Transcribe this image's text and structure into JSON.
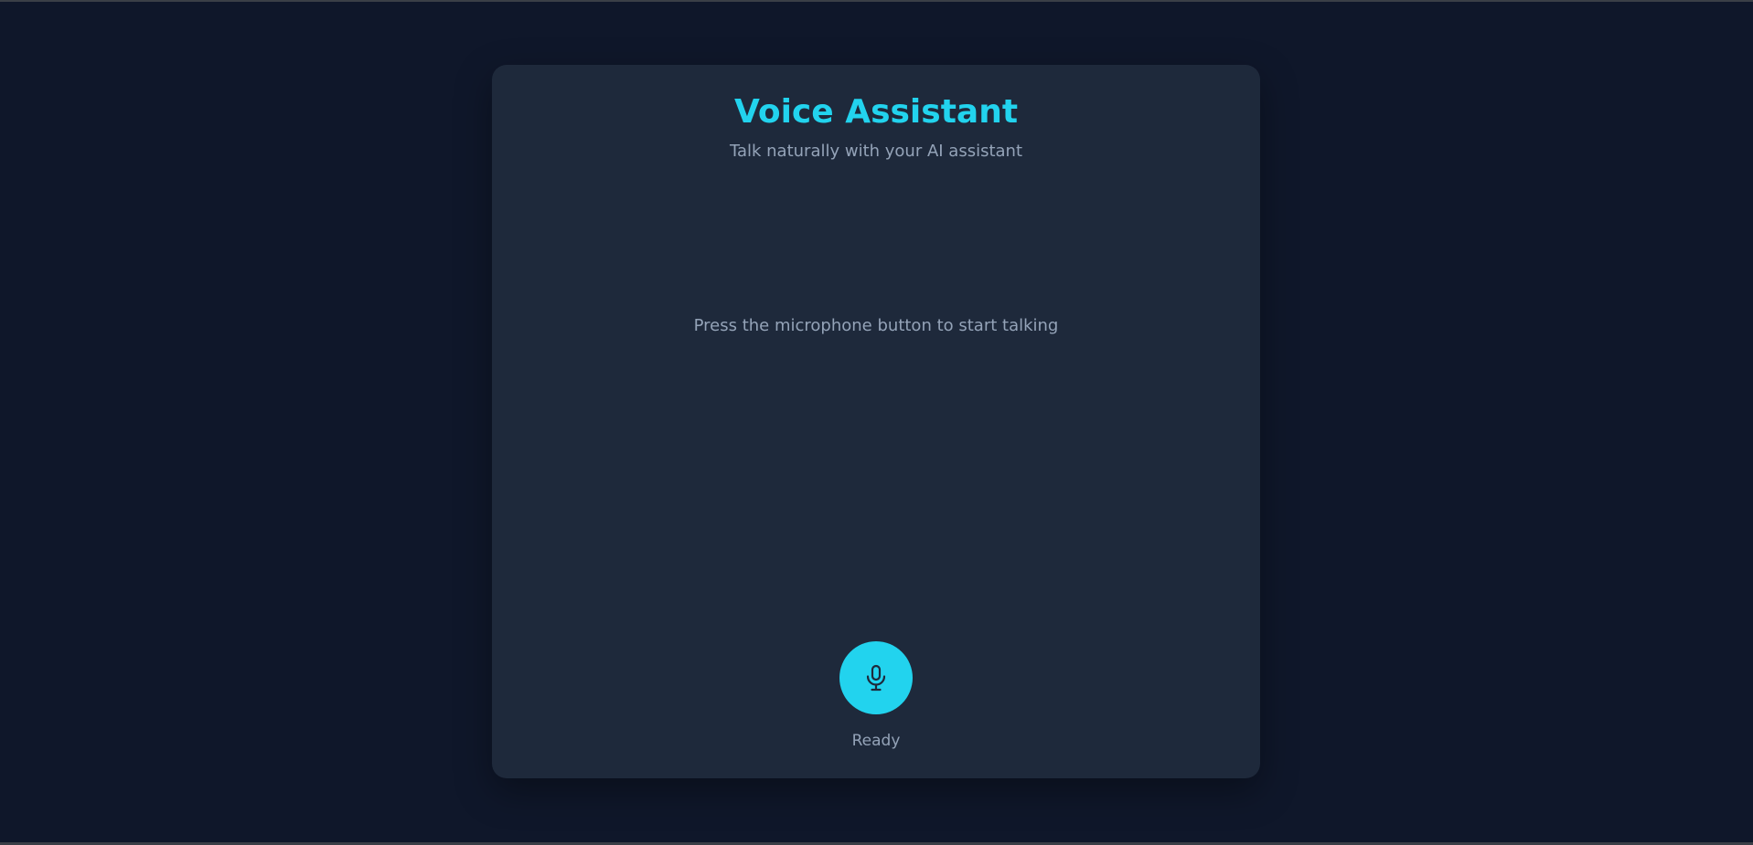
{
  "header": {
    "title": "Voice Assistant",
    "subtitle": "Talk naturally with your AI assistant"
  },
  "conversation": {
    "empty_message": "Press the microphone button to start talking"
  },
  "controls": {
    "mic_icon": "microphone-icon",
    "mic_aria_label": "Microphone",
    "status": "Ready"
  },
  "colors": {
    "page_background": "#0f172a",
    "card_background": "#1e293b",
    "accent": "#22d3ee",
    "muted_text": "#94a3b8",
    "icon_color": "#1e293b"
  }
}
